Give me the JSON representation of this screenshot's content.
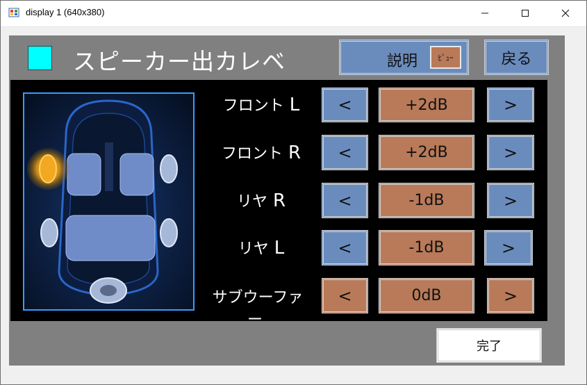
{
  "window": {
    "title": "display 1 (640x380)",
    "minimize_icon": "minimize-icon",
    "maximize_icon": "maximize-icon",
    "close_icon": "close-icon"
  },
  "header": {
    "indicator_color": "#00ffff",
    "title": "スピーカー出カレベ",
    "help_label": "説明",
    "help_hint": "ﾋﾞｭｰ",
    "back_label": "戻る"
  },
  "speakers": [
    {
      "name": "フロント",
      "channel": "L",
      "dec": "<",
      "value": "+2dB",
      "inc": ">",
      "dec_color": "#6a8cbd",
      "inc_color": "#6a8cbd"
    },
    {
      "name": "フロント",
      "channel": "R",
      "dec": "<",
      "value": "+2dB",
      "inc": ">",
      "dec_color": "#6a8cbd",
      "inc_color": "#6a8cbd"
    },
    {
      "name": "リヤ",
      "channel": "R",
      "dec": "<",
      "value": "-1dB",
      "inc": ">",
      "dec_color": "#6a8cbd",
      "inc_color": "#6a8cbd"
    },
    {
      "name": "リヤ",
      "channel": "L",
      "dec": "<",
      "value": "-1dB",
      "inc": ">",
      "dec_color": "#6a8cbd",
      "inc_color": "#6a8cbd"
    },
    {
      "name": "サブウーファー",
      "channel": "",
      "dec": "<",
      "value": "0dB",
      "inc": ">",
      "dec_color": "#b87a59",
      "inc_color": "#b87a59"
    }
  ],
  "footer": {
    "finish_label": "完了"
  },
  "colors": {
    "panel": "#808080",
    "blue_button": "#6a8cbd",
    "orange_button": "#b87a59",
    "highlight_speaker": "#ffa500"
  }
}
